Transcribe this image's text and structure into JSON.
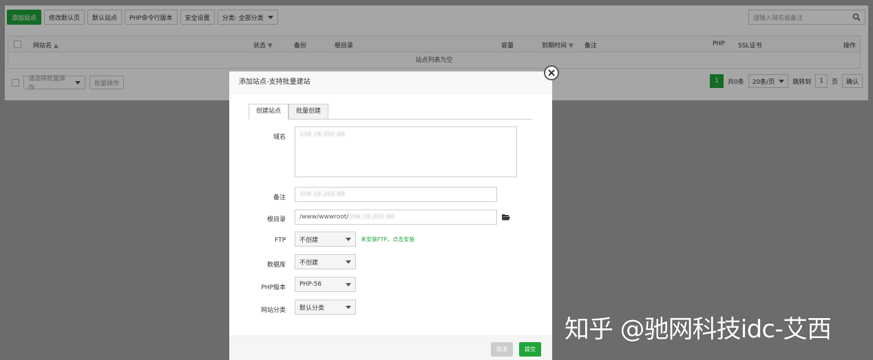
{
  "toolbar": {
    "add_site": "添加站点",
    "edit_default_page": "修改默认页",
    "default_site": "默认站点",
    "php_cli_version": "PHP命令行版本",
    "security": "安全设置",
    "category_select": "分类: 全部分类"
  },
  "search": {
    "placeholder": "请输入域名或备注"
  },
  "table": {
    "headers": {
      "site_name": "网站名",
      "status": "状态",
      "backup": "备份",
      "root_dir": "根目录",
      "capacity": "容量",
      "expire": "到期时间",
      "note": "备注",
      "php": "PHP",
      "ssl": "SSL证书",
      "action": "操作"
    },
    "empty_text": "站点列表为空"
  },
  "batch": {
    "select_placeholder": "请选择批量操作",
    "button": "批量操作"
  },
  "pager": {
    "current_page": "1",
    "total": "共0条",
    "per_page": "20条/页",
    "jump_to": "跳转到",
    "jump_value": "1",
    "page_unit": "页",
    "confirm": "确认"
  },
  "modal": {
    "title": "添加站点-支持批量建站",
    "tabs": [
      "创建站点",
      "批量创建"
    ],
    "labels": {
      "domain": "域名",
      "note": "备注",
      "root": "根目录",
      "ftp": "FTP",
      "database": "数据库",
      "php_version": "PHP版本",
      "site_category": "网站分类"
    },
    "values": {
      "domain": "104.18.202.68",
      "note": "104.18.202.68",
      "root_prefix": "/www/wwwroot/",
      "root_blurred": "104.18.202.68",
      "ftp": "不创建",
      "database": "不创建",
      "php_version": "PHP-56",
      "site_category": "默认分类"
    },
    "ftp_hint": "未安装FTP，点击安装",
    "cancel": "取消",
    "submit": "提交"
  },
  "watermark": "知乎 @驰网科技idc-艾西",
  "colors": {
    "accent": "#20a53a",
    "overlay": "rgba(0,0,0,0.35)"
  }
}
